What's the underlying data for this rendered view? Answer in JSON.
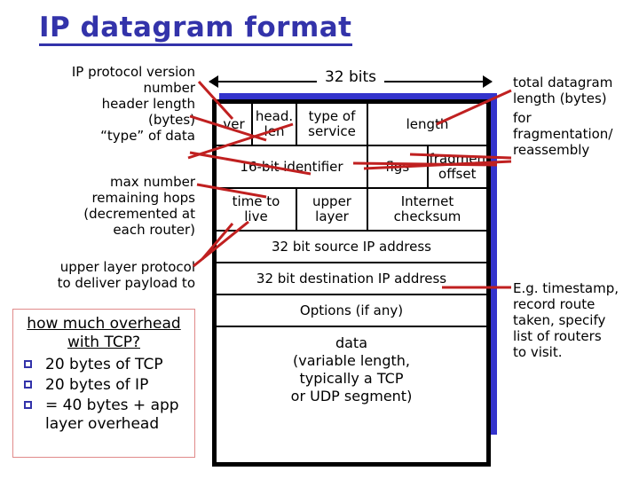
{
  "title": "IP datagram format",
  "ruler": {
    "label": "32 bits",
    "arrow_left": "left-arrow-icon",
    "arrow_right": "right-arrow-icon"
  },
  "datagram": {
    "rows": [
      {
        "name": "row-version",
        "cells": [
          {
            "name": "cell-ver",
            "text": "ver"
          },
          {
            "name": "cell-head-len",
            "line1": "head.",
            "line2": "len"
          },
          {
            "name": "cell-type-of-service",
            "line1": "type of",
            "line2": "service"
          },
          {
            "name": "cell-length",
            "text": "length"
          }
        ]
      },
      {
        "name": "row-identifier",
        "cells": [
          {
            "name": "cell-identifier",
            "text": "16-bit identifier"
          },
          {
            "name": "cell-flags",
            "text": "flgs"
          },
          {
            "name": "cell-fragment-offset",
            "line1": "fragment",
            "line2": "offset"
          }
        ]
      },
      {
        "name": "row-ttl",
        "cells": [
          {
            "name": "cell-time-to-live",
            "line1": "time to",
            "line2": "live"
          },
          {
            "name": "cell-upper-layer",
            "line1": "upper",
            "line2": "layer"
          },
          {
            "name": "cell-internet-checksum",
            "line1": "Internet",
            "line2": "checksum"
          }
        ]
      },
      {
        "name": "row-source-address",
        "cells": [
          {
            "name": "cell-source-ip",
            "text": "32 bit source IP address"
          }
        ]
      },
      {
        "name": "row-destination-address",
        "cells": [
          {
            "name": "cell-destination-ip",
            "text": "32 bit destination IP address"
          }
        ]
      },
      {
        "name": "row-options",
        "cells": [
          {
            "name": "cell-options",
            "text": "Options (if any)"
          }
        ]
      },
      {
        "name": "row-data",
        "cells": [
          {
            "name": "cell-data",
            "line1": "data",
            "line2": "(variable length,",
            "line3": "typically a TCP",
            "line4": "or UDP segment)"
          }
        ]
      }
    ]
  },
  "annotations": {
    "version": "IP protocol version\nnumber\nheader length\n(bytes)\n“type” of data",
    "max_hops": "max number\nremaining hops\n(decremented at\neach router)",
    "upper_layer": "upper layer protocol\nto deliver payload to",
    "total_length": "total datagram\nlength (bytes)",
    "fragmentation": "for\nfragmentation/\nreassembly",
    "options": "E.g. timestamp,\nrecord route\ntaken, specify\nlist of routers\nto visit."
  },
  "overhead": {
    "title": "how much overhead\nwith TCP?",
    "items": [
      "20 bytes of TCP",
      "20 bytes of IP",
      "= 40 bytes + app\nlayer overhead"
    ],
    "bullet_icon": "square-bullet-icon"
  },
  "colors": {
    "title_blue": "#3333aa",
    "shadow_blue": "#3333cc",
    "arrow_red": "#c02020",
    "box_border_pink": "#e08a8a",
    "bullet_blue": "#3333aa"
  }
}
